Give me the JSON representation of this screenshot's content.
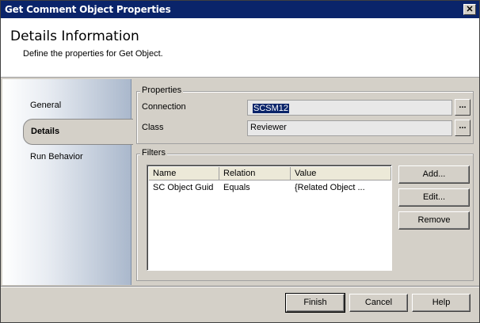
{
  "window": {
    "title": "Get Comment Object Properties",
    "close_glyph": "✕"
  },
  "header": {
    "title": "Details Information",
    "subtitle": "Define the properties for Get Object."
  },
  "sidebar": {
    "items": [
      {
        "label": "General"
      },
      {
        "label": "Details",
        "active": true
      },
      {
        "label": "Run Behavior"
      }
    ]
  },
  "properties": {
    "legend": "Properties",
    "connection_label": "Connection",
    "connection_value": "SCSM12",
    "class_label": "Class",
    "class_value": "Reviewer",
    "browse_glyph": "..."
  },
  "filters": {
    "legend": "Filters",
    "columns": [
      "Name",
      "Relation",
      "Value"
    ],
    "rows": [
      [
        "SC Object Guid",
        "Equals",
        "{Related Object ..."
      ]
    ],
    "buttons": {
      "add": "Add...",
      "edit": "Edit...",
      "remove": "Remove"
    }
  },
  "footer": {
    "finish": "Finish",
    "cancel": "Cancel",
    "help": "Help"
  },
  "colors": {
    "titlebar": "#0a246a",
    "dialog_face": "#d4d0c8",
    "selection": "#0a246a"
  }
}
